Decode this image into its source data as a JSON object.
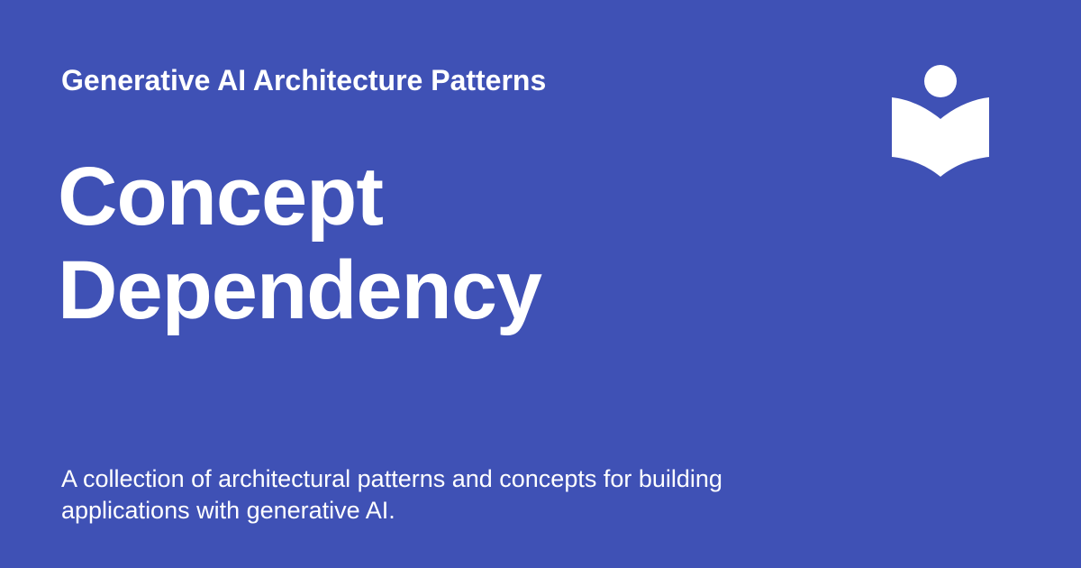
{
  "colors": {
    "background": "#3f51b5",
    "foreground": "#ffffff"
  },
  "header": {
    "site_name": "Generative AI Architecture Patterns",
    "logo_icon": "reader-book-icon"
  },
  "main": {
    "title_lines": [
      "Concept",
      "Dependency"
    ]
  },
  "footer": {
    "description_lines": [
      "A collection of architectural patterns and concepts for building",
      "applications with generative AI."
    ]
  }
}
